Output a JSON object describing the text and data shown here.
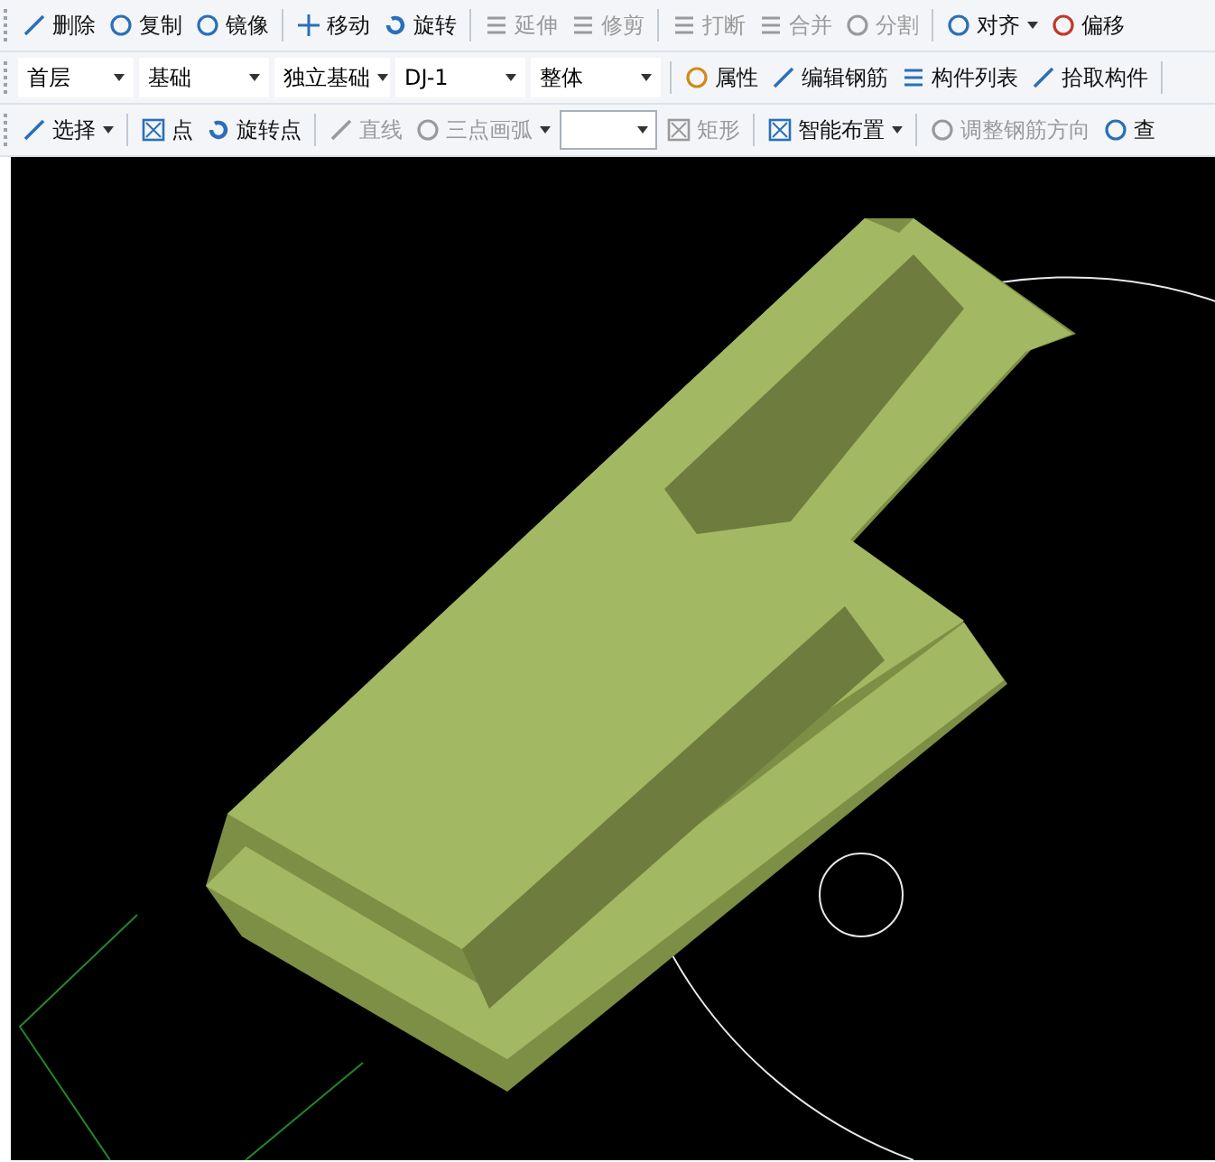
{
  "toolbars": [
    {
      "items": [
        {
          "kind": "button",
          "label": "删除",
          "disabled": false,
          "dropdown": false
        },
        {
          "kind": "button",
          "label": "复制",
          "disabled": false,
          "dropdown": false
        },
        {
          "kind": "button",
          "label": "镜像",
          "disabled": false,
          "dropdown": false
        },
        {
          "kind": "separator"
        },
        {
          "kind": "button",
          "label": "移动",
          "disabled": false,
          "dropdown": false
        },
        {
          "kind": "button",
          "label": "旋转",
          "disabled": false,
          "dropdown": false
        },
        {
          "kind": "separator"
        },
        {
          "kind": "button",
          "label": "延伸",
          "disabled": true,
          "dropdown": false
        },
        {
          "kind": "button",
          "label": "修剪",
          "disabled": true,
          "dropdown": false
        },
        {
          "kind": "separator"
        },
        {
          "kind": "button",
          "label": "打断",
          "disabled": true,
          "dropdown": false
        },
        {
          "kind": "button",
          "label": "合并",
          "disabled": true,
          "dropdown": false
        },
        {
          "kind": "button",
          "label": "分割",
          "disabled": true,
          "dropdown": false
        },
        {
          "kind": "separator"
        },
        {
          "kind": "button",
          "label": "对齐",
          "disabled": false,
          "dropdown": true
        },
        {
          "kind": "button",
          "label": "偏移",
          "disabled": false,
          "dropdown": false
        }
      ]
    },
    {
      "items": [
        {
          "kind": "combo",
          "value": "首层"
        },
        {
          "kind": "combo",
          "value": "基础"
        },
        {
          "kind": "combo",
          "value": "独立基础"
        },
        {
          "kind": "combo",
          "value": "DJ-1"
        },
        {
          "kind": "combo",
          "value": "整体"
        },
        {
          "kind": "separator"
        },
        {
          "kind": "button",
          "label": "属性",
          "disabled": false,
          "dropdown": false
        },
        {
          "kind": "button",
          "label": "编辑钢筋",
          "disabled": false,
          "dropdown": false
        },
        {
          "kind": "button",
          "label": "构件列表",
          "disabled": false,
          "dropdown": false
        },
        {
          "kind": "button",
          "label": "拾取构件",
          "disabled": false,
          "dropdown": false
        },
        {
          "kind": "separator"
        }
      ]
    },
    {
      "items": [
        {
          "kind": "button",
          "label": "选择",
          "disabled": false,
          "dropdown": true
        },
        {
          "kind": "separator"
        },
        {
          "kind": "button",
          "label": "点",
          "disabled": false,
          "dropdown": false
        },
        {
          "kind": "button",
          "label": "旋转点",
          "disabled": false,
          "dropdown": false
        },
        {
          "kind": "separator"
        },
        {
          "kind": "button",
          "label": "直线",
          "disabled": true,
          "dropdown": false
        },
        {
          "kind": "button",
          "label": "三点画弧",
          "disabled": true,
          "dropdown": true
        },
        {
          "kind": "combo",
          "value": ""
        },
        {
          "kind": "button",
          "label": "矩形",
          "disabled": true,
          "dropdown": false
        },
        {
          "kind": "separator"
        },
        {
          "kind": "button",
          "label": "智能布置",
          "disabled": false,
          "dropdown": true
        },
        {
          "kind": "separator"
        },
        {
          "kind": "button",
          "label": "调整钢筋方向",
          "disabled": true,
          "dropdown": false
        },
        {
          "kind": "button",
          "label": "查",
          "disabled": false,
          "dropdown": false
        }
      ]
    }
  ]
}
